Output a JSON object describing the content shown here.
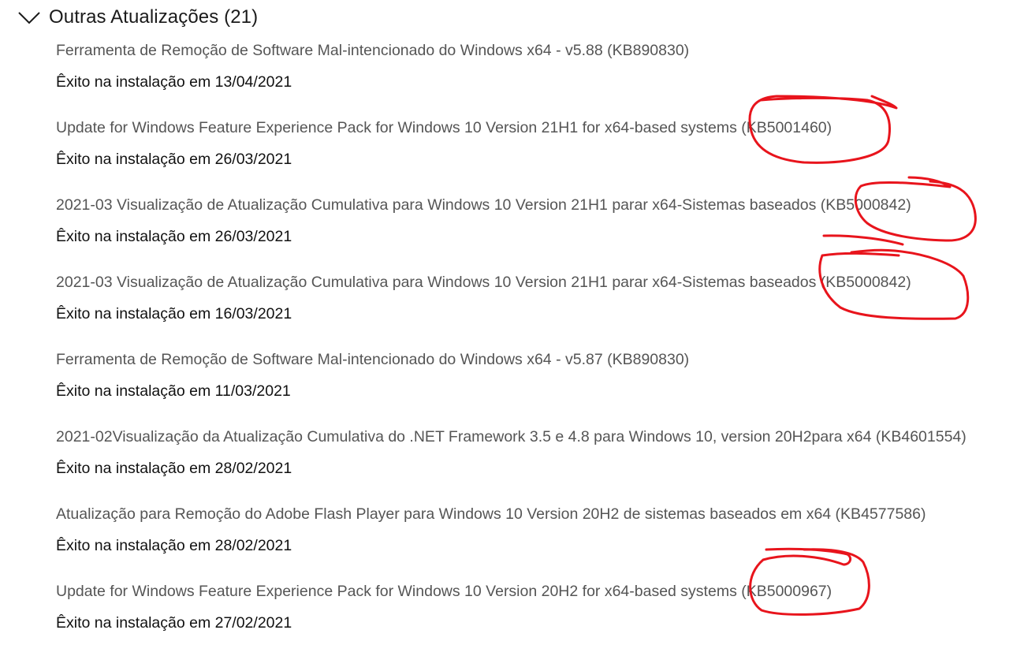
{
  "section": {
    "title": "Outras Atualizações (21)",
    "chevron_icon": "chevron-down-icon"
  },
  "updates": [
    {
      "name": "Ferramenta de Remoção de Software Mal-intencionado do Windows x64 - v5.88 (KB890830)",
      "status": "Êxito na instalação em 13/04/2021"
    },
    {
      "name": "Update for Windows Feature Experience Pack for Windows 10 Version 21H1 for x64-based systems (KB5001460)",
      "status": "Êxito na instalação em 26/03/2021"
    },
    {
      "name": "2021-03 Visualização de Atualização Cumulativa para Windows 10 Version 21H1 parar x64-Sistemas baseados (KB5000842)",
      "status": "Êxito na instalação em 26/03/2021"
    },
    {
      "name": "2021-03 Visualização de Atualização Cumulativa para Windows 10 Version 21H1 parar x64-Sistemas baseados (KB5000842)",
      "status": "Êxito na instalação em 16/03/2021"
    },
    {
      "name": "Ferramenta de Remoção de Software Mal-intencionado do Windows x64 - v5.87 (KB890830)",
      "status": "Êxito na instalação em 11/03/2021"
    },
    {
      "name": "2021-02Visualização da Atualização Cumulativa do .NET Framework 3.5 e 4.8 para Windows 10, version 20H2para x64 (KB4601554)",
      "status": "Êxito na instalação em 28/02/2021"
    },
    {
      "name": "Atualização para Remoção do Adobe Flash Player para Windows 10 Version 20H2 de sistemas baseados em x64 (KB4577586)",
      "status": "Êxito na instalação em 28/02/2021"
    },
    {
      "name": "Update for Windows Feature Experience Pack for Windows 10 Version 20H2 for x64-based systems (KB5000967)",
      "status": "Êxito na instalação em 27/02/2021"
    }
  ],
  "colors": {
    "annotation": "#e8141c",
    "update_name": "#555555",
    "status_text": "#111111"
  }
}
